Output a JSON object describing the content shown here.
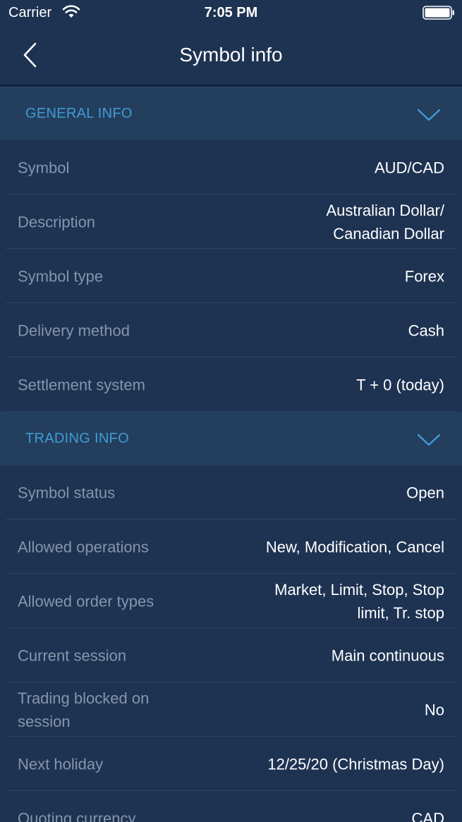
{
  "status_bar": {
    "carrier": "Carrier",
    "time": "7:05 PM"
  },
  "nav": {
    "title": "Symbol info"
  },
  "general_info": {
    "header": "GENERAL INFO",
    "rows": [
      {
        "key": "Symbol",
        "value": "AUD/CAD"
      },
      {
        "key": "Description",
        "value": "Australian Dollar/ Canadian Dollar"
      },
      {
        "key": "Symbol type",
        "value": "Forex"
      },
      {
        "key": "Delivery method",
        "value": "Cash"
      },
      {
        "key": "Settlement system",
        "value": "T + 0 (today)"
      }
    ]
  },
  "trading_info": {
    "header": "TRADING INFO",
    "rows": [
      {
        "key": "Symbol status",
        "value": "Open"
      },
      {
        "key": "Allowed operations",
        "value": "New, Modification, Cancel"
      },
      {
        "key": "Allowed order types",
        "value": "Market, Limit, Stop, Stop limit, Tr. stop"
      },
      {
        "key": "Current session",
        "value": "Main continuous"
      },
      {
        "key": "Trading blocked on session",
        "value": "No"
      },
      {
        "key": "Next holiday",
        "value": "12/25/20 (Christmas Day)"
      },
      {
        "key": "Quoting currency",
        "value": "CAD"
      }
    ]
  },
  "colors": {
    "background": "#1e3352",
    "section_header": "#243e5e",
    "accent": "#3f9cd4",
    "key_text": "#8496ab",
    "value_text": "#ffffff"
  }
}
